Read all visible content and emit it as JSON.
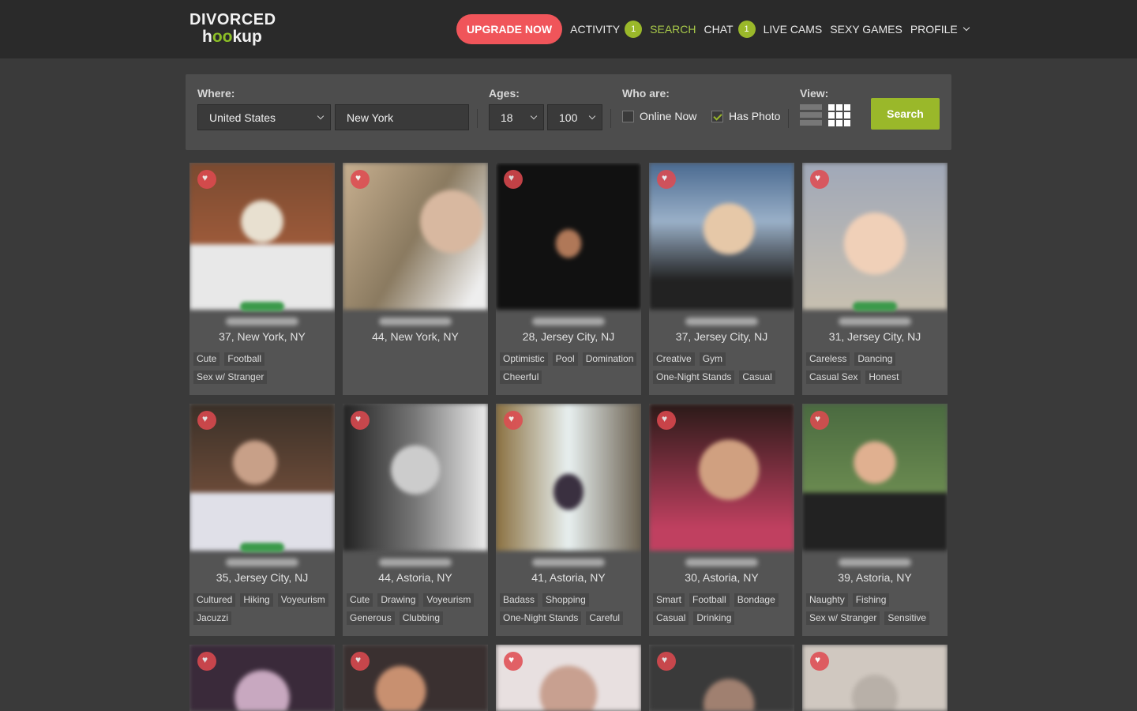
{
  "header": {
    "logo_line1": "DIVORCED",
    "logo_line2_a": "h",
    "logo_line2_oo": "oo",
    "logo_line2_b": "kup",
    "upgrade_label": "UPGRADE NOW",
    "nav": {
      "activity": "ACTIVITY",
      "activity_badge": "1",
      "search": "SEARCH",
      "chat": "CHAT",
      "chat_badge": "1",
      "live_cams": "LIVE CAMS",
      "sexy_games": "SEXY GAMES",
      "profile": "PROFILE"
    }
  },
  "filters": {
    "where_label": "Where:",
    "country": "United States",
    "city": "New York",
    "ages_label": "Ages:",
    "age_min": "18",
    "age_max": "100",
    "who_label": "Who are:",
    "online_now": "Online Now",
    "online_now_checked": false,
    "has_photo": "Has Photo",
    "has_photo_checked": true,
    "view_label": "View:",
    "search_label": "Search"
  },
  "cards": [
    {
      "loc": "37, New York, NY",
      "tags": [
        "Cute",
        "Football",
        "Sex w/ Stranger"
      ],
      "online": true
    },
    {
      "loc": "44, New York, NY",
      "tags": [],
      "online": false
    },
    {
      "loc": "28, Jersey City, NJ",
      "tags": [
        "Optimistic",
        "Pool",
        "Domination",
        "Cheerful"
      ],
      "online": false
    },
    {
      "loc": "37, Jersey City, NJ",
      "tags": [
        "Creative",
        "Gym",
        "One-Night Stands",
        "Casual"
      ],
      "online": false
    },
    {
      "loc": "31, Jersey City, NJ",
      "tags": [
        "Careless",
        "Dancing",
        "Casual Sex",
        "Honest"
      ],
      "online": true
    },
    {
      "loc": "35, Jersey City, NJ",
      "tags": [
        "Cultured",
        "Hiking",
        "Voyeurism",
        "Jacuzzi"
      ],
      "online": true
    },
    {
      "loc": "44, Astoria, NY",
      "tags": [
        "Cute",
        "Drawing",
        "Voyeurism",
        "Generous",
        "Clubbing"
      ],
      "online": false
    },
    {
      "loc": "41, Astoria, NY",
      "tags": [
        "Badass",
        "Shopping",
        "One-Night Stands",
        "Careful"
      ],
      "online": false
    },
    {
      "loc": "30, Astoria, NY",
      "tags": [
        "Smart",
        "Football",
        "Bondage",
        "Casual",
        "Drinking"
      ],
      "online": false
    },
    {
      "loc": "39, Astoria, NY",
      "tags": [
        "Naughty",
        "Fishing",
        "Sex w/ Stranger",
        "Sensitive"
      ],
      "online": false
    }
  ],
  "colors": {
    "accent_green": "#9ab82a",
    "upgrade_red": "#f0555a",
    "header_bg": "#2a2a2a",
    "page_bg": "#3a3a3a"
  }
}
